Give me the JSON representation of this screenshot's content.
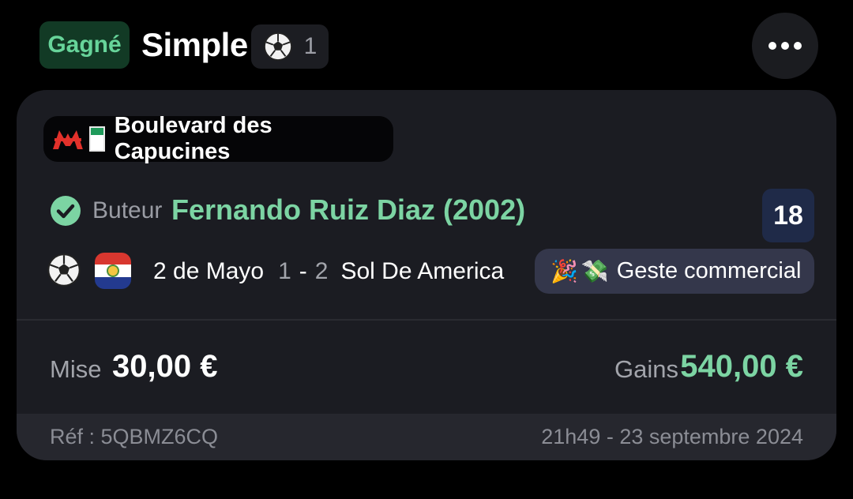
{
  "header": {
    "status_badge": "Gagné",
    "bet_type": "Simple",
    "selection_count_icon": "soccer-ball-icon",
    "selection_count": "1",
    "more_icon": "more-horizontal-icon"
  },
  "card": {
    "venue": {
      "logo_icon": "red-m-logo-icon",
      "flag_icon": "green-white-flag-icon",
      "name": "Boulevard des Capucines"
    },
    "selection": {
      "status_icon": "check-circle-icon",
      "market": "Buteur",
      "name": "Fernando Ruiz Diaz (2002)",
      "odds": "18"
    },
    "match": {
      "sport_icon": "soccer-ball-icon",
      "country_flag_icon": "paraguay-flag-icon",
      "home_team": "2 de Mayo",
      "home_score": "1",
      "score_separator": "-",
      "away_score": "2",
      "away_team": "Sol De America"
    },
    "promo": {
      "emoji_1": "🎉",
      "emoji_2": "💸",
      "label": "Geste commercial"
    },
    "stake": {
      "label": "Mise",
      "value": "30,00 €"
    },
    "winnings": {
      "label": "Gains",
      "value": "540,00 €"
    },
    "footer": {
      "ref": "Réf : 5QBMZ6CQ",
      "datetime": "21h49 - 23 septembre 2024"
    }
  },
  "colors": {
    "background": "#000000",
    "card": "#1b1c22",
    "accent_green": "#7cd4a3",
    "badge_green_bg": "#123a25",
    "odds_bg": "#1f2a48",
    "promo_bg": "#34374b"
  }
}
